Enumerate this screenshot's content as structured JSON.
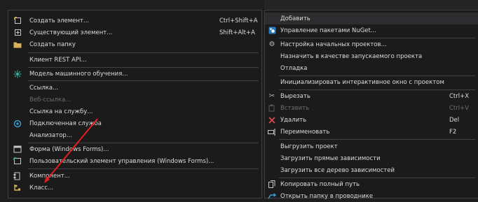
{
  "left_menu": {
    "items": [
      {
        "label": "Создать элемент...",
        "shortcut": "Ctrl+Shift+A",
        "icon": "new-item-icon"
      },
      {
        "label": "Существующий элемент...",
        "shortcut": "Shift+Alt+A",
        "icon": "existing-item-icon"
      },
      {
        "label": "Создать папку",
        "icon": "folder-icon"
      },
      {
        "label": "Клиент REST API..."
      },
      {
        "label": "Модель машинного обучения...",
        "icon": "ml-model-icon"
      },
      {
        "label": "Ссылка..."
      },
      {
        "label": "Веб-ссылка...",
        "disabled": true
      },
      {
        "label": "Ссылка на службу..."
      },
      {
        "label": "Подключенная служба",
        "icon": "connected-service-icon"
      },
      {
        "label": "Анализатор..."
      },
      {
        "label": "Форма (Windows Forms)...",
        "icon": "form-icon"
      },
      {
        "label": "Пользовательский элемент управления (Windows Forms)...",
        "icon": "user-control-icon"
      },
      {
        "label": "Компонент...",
        "icon": "component-icon"
      },
      {
        "label": "Класс...",
        "icon": "class-icon"
      }
    ]
  },
  "right_menu": {
    "top_text": "",
    "items": [
      {
        "label": "Добавить"
      },
      {
        "label": "Управление пакетами NuGet...",
        "icon": "nuget-icon"
      },
      {
        "label": "Настройка начальных проектов...",
        "icon": "gear-icon"
      },
      {
        "label": "Назначить в качестве запускаемого проекта"
      },
      {
        "label": "Отладка"
      },
      {
        "label": "Инициализировать интерактивное окно с проектом"
      },
      {
        "label": "Вырезать",
        "shortcut": "Ctrl+X",
        "icon": "scissors-icon"
      },
      {
        "label": "Вставить",
        "shortcut": "Ctrl+V",
        "icon": "paste-icon",
        "disabled": true
      },
      {
        "label": "Удалить",
        "shortcut": "Del",
        "icon": "delete-icon"
      },
      {
        "label": "Переименовать",
        "shortcut": "F2",
        "icon": "rename-icon"
      },
      {
        "label": "Выгрузить проект"
      },
      {
        "label": "Загрузить прямые зависимости"
      },
      {
        "label": "Загрузить все дерево зависимостей"
      },
      {
        "label": "Копировать полный путь",
        "icon": "copy-path-icon"
      },
      {
        "label": "Открыть папку в проводнике",
        "icon": "open-folder-icon"
      }
    ]
  },
  "colors": {
    "menu_bg": "#1b1b1c",
    "border": "#3f3f46",
    "highlight": "#2d2d30",
    "arrow": "#e02020"
  }
}
